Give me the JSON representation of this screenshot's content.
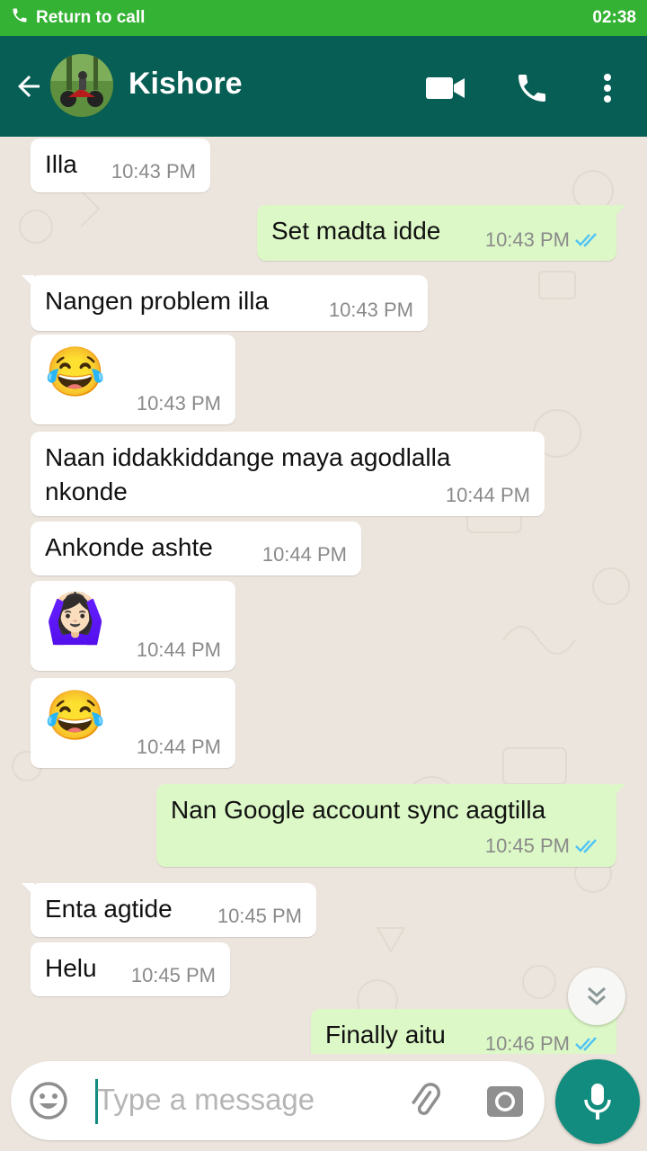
{
  "status_bar": {
    "call_label": "Return to call",
    "time": "02:38"
  },
  "header": {
    "contact_name": "Kishore"
  },
  "messages": [
    {
      "dir": "in",
      "text": "Illa",
      "time": "10:43 PM"
    },
    {
      "dir": "out",
      "text": "Set madta idde",
      "time": "10:43 PM"
    },
    {
      "dir": "in",
      "text": "Nangen problem illa",
      "time": "10:43 PM"
    },
    {
      "dir": "in",
      "emoji": "😂",
      "time": "10:43 PM"
    },
    {
      "dir": "in",
      "text": "Naan iddakkiddange maya agodlalla nkonde",
      "time": "10:44 PM"
    },
    {
      "dir": "in",
      "text": "Ankonde ashte",
      "time": "10:44 PM"
    },
    {
      "dir": "in",
      "emoji": "🙆🏻‍♀️",
      "time": "10:44 PM"
    },
    {
      "dir": "in",
      "emoji": "😂",
      "time": "10:44 PM"
    },
    {
      "dir": "out",
      "text": "Nan Google account sync aagtilla",
      "time": "10:45 PM"
    },
    {
      "dir": "in",
      "text": "Enta agtide",
      "time": "10:45 PM"
    },
    {
      "dir": "in",
      "text": "Helu",
      "time": "10:45 PM"
    },
    {
      "dir": "out",
      "text": "Finally aitu",
      "time": "10:46 PM"
    }
  ],
  "input": {
    "placeholder": "Type a message"
  },
  "colors": {
    "header": "#075e54",
    "call_bar": "#34b233",
    "outgoing_bubble": "#dcf8c6",
    "incoming_bubble": "#ffffff",
    "read_ticks": "#4fc3f7",
    "mic_button": "#128c7e"
  },
  "icons": [
    "phone-icon",
    "back-arrow-icon",
    "video-call-icon",
    "voice-call-icon",
    "more-vert-icon",
    "double-check-icon",
    "chevron-double-down-icon",
    "emoji-icon",
    "attach-icon",
    "camera-icon",
    "mic-icon"
  ]
}
